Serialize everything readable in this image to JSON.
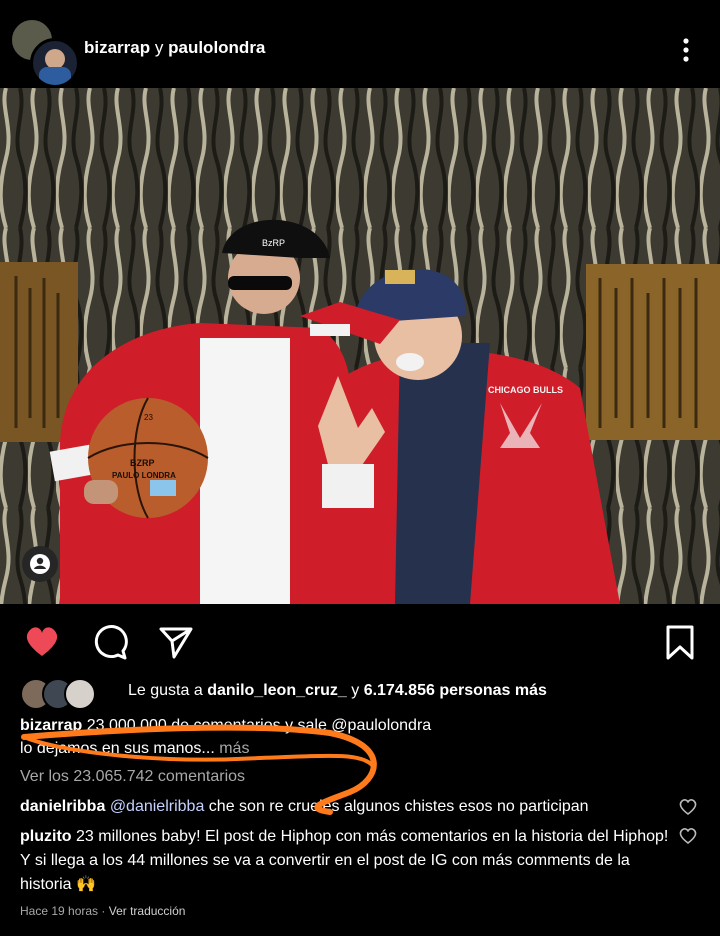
{
  "header": {
    "user1": "bizarrap",
    "connector": "y",
    "user2": "paulolondra"
  },
  "post": {
    "likes": {
      "prefix": "Le gusta a",
      "user": "danilo_leon_cruz_",
      "connector": "y",
      "count_text": "6.174.856 personas más"
    },
    "caption": {
      "user": "bizarrap",
      "text": "23.000.000 de comentarios y sale @paulolondra",
      "line2": "lo dejamos en sus manos...",
      "more": "más"
    },
    "view_comments": "Ver los 23.065.742 comentarios",
    "comments": [
      {
        "user": "danielribba",
        "mention": "@danielribba",
        "text": "che son re crueles algunos chistes esos no participan"
      },
      {
        "user": "pluzito",
        "text": "23 millones baby! El post de Hiphop con más comentarios en la historia del Hiphop! Y si llega a los 44 millones se va a convertir en el post de IG con más comments de la historia 🙌"
      }
    ],
    "time": "Hace 19 horas",
    "separator": "·",
    "translate": "Ver traducción"
  },
  "image_text": {
    "cap_logo": "BzRP",
    "ball_text1": "BZRP",
    "ball_text2": "PAULO LONDRA",
    "ball_number": "23",
    "jacket_text": "CHICAGO BULLS"
  },
  "colors": {
    "liked_heart": "#ed4956",
    "annotation": "#ff7a1a",
    "jacket": "#d01d2a"
  },
  "icons": {
    "more": "vertical-dots-icon",
    "like": "heart-filled-icon",
    "comment": "speech-bubble-icon",
    "share": "paper-plane-icon",
    "save": "bookmark-icon",
    "user_tag": "person-icon"
  }
}
